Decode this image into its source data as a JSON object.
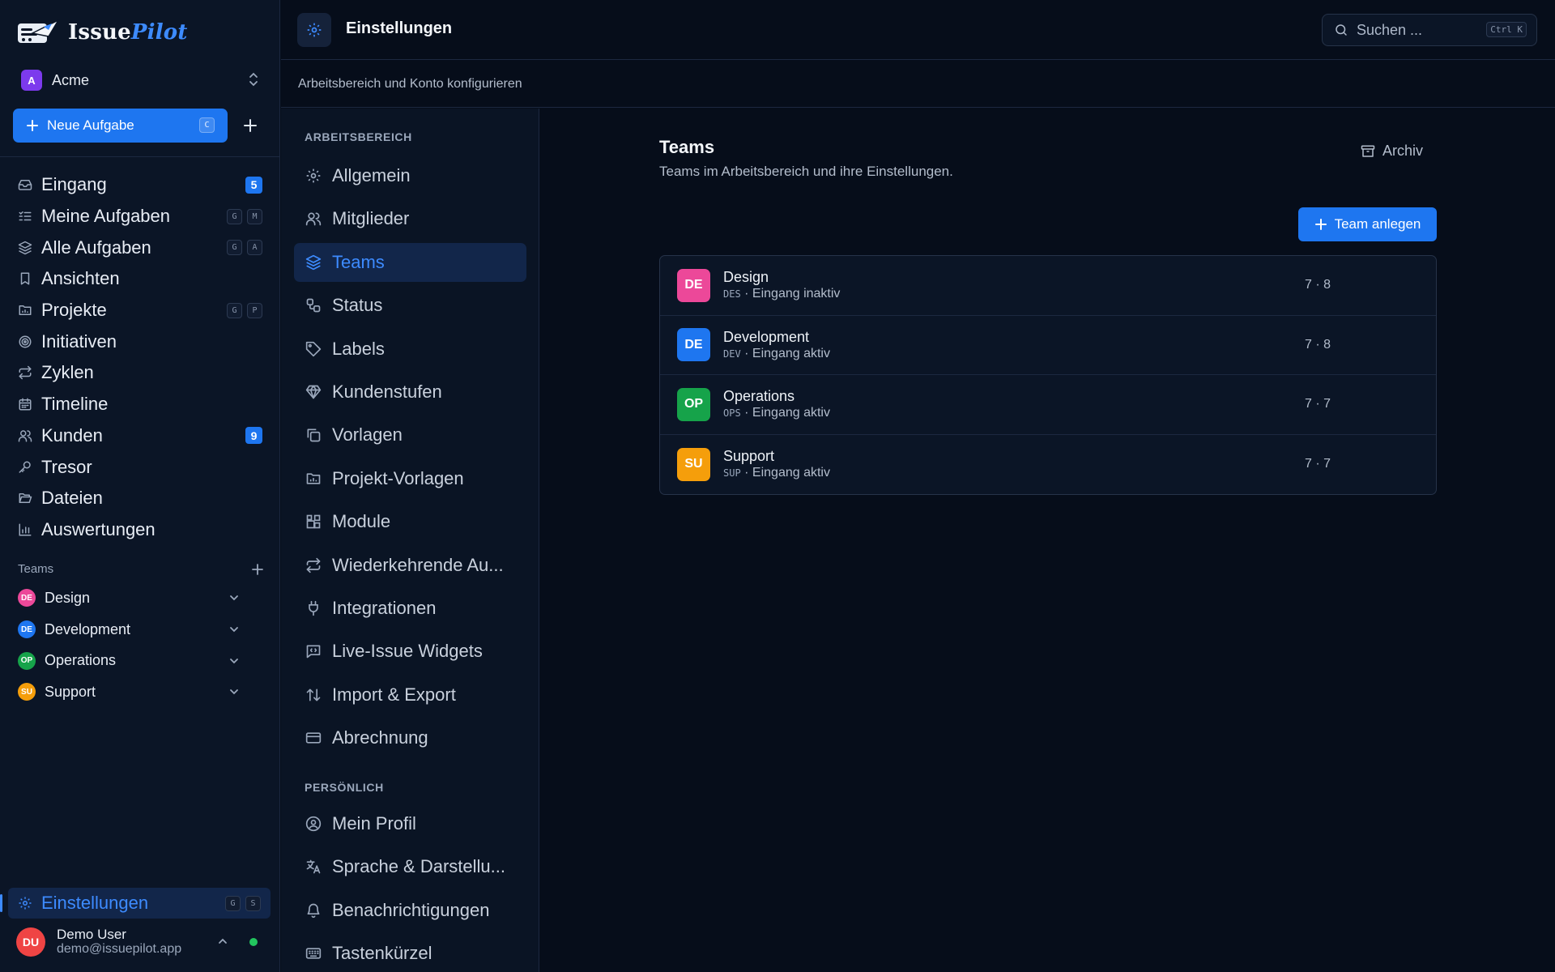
{
  "app": {
    "name_part1": "Issue",
    "name_part2": "Pilot"
  },
  "workspace": {
    "initial": "A",
    "name": "Acme"
  },
  "new_task": {
    "label": "Neue Aufgabe",
    "shortcut": "C"
  },
  "nav": [
    {
      "label": "Eingang",
      "icon": "inbox-icon",
      "count": "5"
    },
    {
      "label": "Meine Aufgaben",
      "icon": "list-check-icon",
      "keys": [
        "G",
        "M"
      ]
    },
    {
      "label": "Alle Aufgaben",
      "icon": "layers-icon",
      "keys": [
        "G",
        "A"
      ]
    },
    {
      "label": "Ansichten",
      "icon": "bookmark-icon"
    },
    {
      "label": "Projekte",
      "icon": "folder-chart-icon",
      "keys": [
        "G",
        "P"
      ]
    },
    {
      "label": "Initiativen",
      "icon": "target-icon"
    },
    {
      "label": "Zyklen",
      "icon": "repeat-icon"
    },
    {
      "label": "Timeline",
      "icon": "calendar-icon"
    },
    {
      "label": "Kunden",
      "icon": "users-icon",
      "count": "9"
    },
    {
      "label": "Tresor",
      "icon": "key-icon"
    },
    {
      "label": "Dateien",
      "icon": "folder-open-icon"
    },
    {
      "label": "Auswertungen",
      "icon": "bar-chart-icon"
    }
  ],
  "teams_section": {
    "title": "Teams"
  },
  "teams": [
    {
      "initials": "DE",
      "name": "Design",
      "color": "#ec4899"
    },
    {
      "initials": "DE",
      "name": "Development",
      "color": "#1e76f0"
    },
    {
      "initials": "OP",
      "name": "Operations",
      "color": "#16a34a"
    },
    {
      "initials": "SU",
      "name": "Support",
      "color": "#f59e0b"
    }
  ],
  "settings_nav": {
    "label": "Einstellungen",
    "keys": [
      "G",
      "S"
    ]
  },
  "user": {
    "initials": "DU",
    "name": "Demo User",
    "email": "demo@issuepilot.app"
  },
  "topbar": {
    "title": "Einstellungen",
    "search_placeholder": "Suchen ...",
    "search_shortcut": "Ctrl K"
  },
  "subtitle": "Arbeitsbereich und Konto konfigurieren",
  "settings_menu": {
    "workspace_title": "ARBEITSBEREICH",
    "workspace_items": [
      {
        "label": "Allgemein",
        "icon": "gear-icon"
      },
      {
        "label": "Mitglieder",
        "icon": "users-icon"
      },
      {
        "label": "Teams",
        "icon": "layers-icon",
        "active": true
      },
      {
        "label": "Status",
        "icon": "workflow-icon"
      },
      {
        "label": "Labels",
        "icon": "tag-icon"
      },
      {
        "label": "Kundenstufen",
        "icon": "diamond-icon"
      },
      {
        "label": "Vorlagen",
        "icon": "copy-icon"
      },
      {
        "label": "Projekt-Vorlagen",
        "icon": "folder-chart-icon"
      },
      {
        "label": "Module",
        "icon": "blocks-icon"
      },
      {
        "label": "Wiederkehrende Au...",
        "icon": "repeat-icon"
      },
      {
        "label": "Integrationen",
        "icon": "plug-icon"
      },
      {
        "label": "Live-Issue Widgets",
        "icon": "message-code-icon"
      },
      {
        "label": "Import & Export",
        "icon": "arrows-updown-icon"
      },
      {
        "label": "Abrechnung",
        "icon": "credit-card-icon"
      }
    ],
    "personal_title": "PERSÖNLICH",
    "personal_items": [
      {
        "label": "Mein Profil",
        "icon": "user-circle-icon"
      },
      {
        "label": "Sprache & Darstellu...",
        "icon": "languages-icon"
      },
      {
        "label": "Benachrichtigungen",
        "icon": "bell-icon"
      },
      {
        "label": "Tastenkürzel",
        "icon": "keyboard-icon"
      }
    ]
  },
  "content": {
    "title": "Teams",
    "subtitle": "Teams im Arbeitsbereich und ihre Einstellungen.",
    "archive_label": "Archiv",
    "create_label": "Team anlegen",
    "rows": [
      {
        "initials": "DE",
        "name": "Design",
        "code": "DES",
        "status": "· Eingang inaktiv",
        "counts": "7 · 8",
        "color": "#ec4899"
      },
      {
        "initials": "DE",
        "name": "Development",
        "code": "DEV",
        "status": "· Eingang aktiv",
        "counts": "7 · 8",
        "color": "#1e76f0"
      },
      {
        "initials": "OP",
        "name": "Operations",
        "code": "OPS",
        "status": "· Eingang aktiv",
        "counts": "7 · 7",
        "color": "#16a34a"
      },
      {
        "initials": "SU",
        "name": "Support",
        "code": "SUP",
        "status": "· Eingang aktiv",
        "counts": "7 · 7",
        "color": "#f59e0b"
      }
    ]
  }
}
